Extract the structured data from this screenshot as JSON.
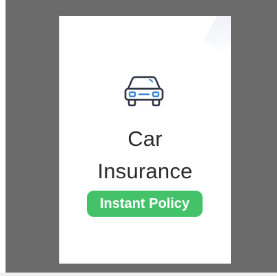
{
  "card": {
    "title_line1": "Car",
    "title_line2": "Insurance",
    "badge_label": "Instant Policy",
    "icon": "car-icon"
  },
  "colors": {
    "backdrop": "#6b6b6b",
    "card": "#ffffff",
    "badge": "#43c26a",
    "icon_stroke": "#2f3545",
    "icon_accent": "#3b86d6"
  }
}
